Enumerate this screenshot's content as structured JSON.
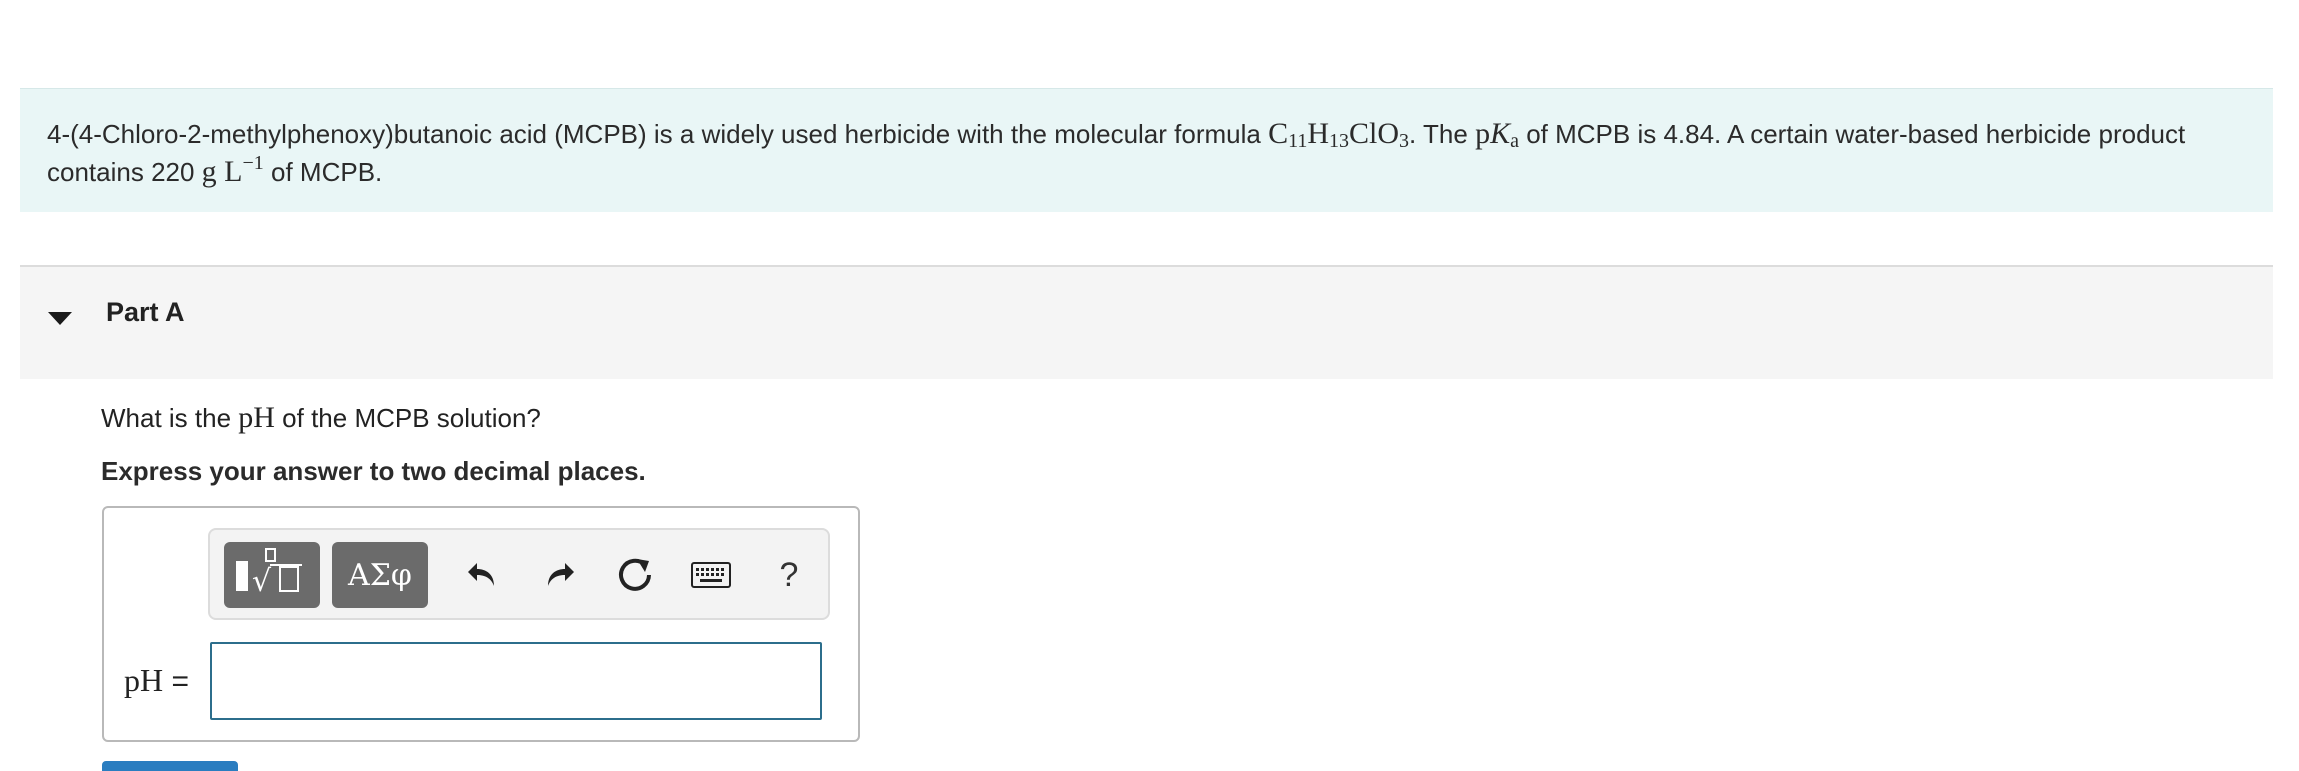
{
  "intro": {
    "text_a": "4-(4-Chloro-2-methylphenoxy)butanoic acid (MCPB) is a widely used herbicide with the molecular formula ",
    "formula": {
      "c": "C",
      "c_sub": "11",
      "h": "H",
      "h_sub": "13",
      "clo": "ClO",
      "o_sub": "3"
    },
    "text_b": ". The ",
    "pka": {
      "p": "p",
      "k": "K",
      "a": "a"
    },
    "text_c": " of MCPB is 4.84. A certain water-based herbicide product contains 220 ",
    "unit": {
      "g": "g",
      "l": "L",
      "exp": "−1"
    },
    "text_d": " of MCPB."
  },
  "part": {
    "title": "Part A",
    "question_a": "What is the ",
    "question_ph": "pH",
    "question_b": " of the MCPB solution?",
    "instruction": "Express your answer to two decimal places."
  },
  "toolbar": {
    "templates_icon": "templates-icon",
    "symbols_label": "ΑΣφ",
    "undo_icon": "undo-icon",
    "redo_icon": "redo-icon",
    "reset_icon": "reset-icon",
    "keyboard_icon": "keyboard-icon",
    "help_label": "?"
  },
  "answer": {
    "label_ph": "pH",
    "label_eq": " =",
    "value": "",
    "placeholder": ""
  },
  "colors": {
    "intro_bg": "#e9f6f6",
    "header_bg": "#f5f5f5",
    "button_bg": "#6b6b6b",
    "input_border": "#2c6e8c",
    "submit": "#2a7dc0"
  }
}
